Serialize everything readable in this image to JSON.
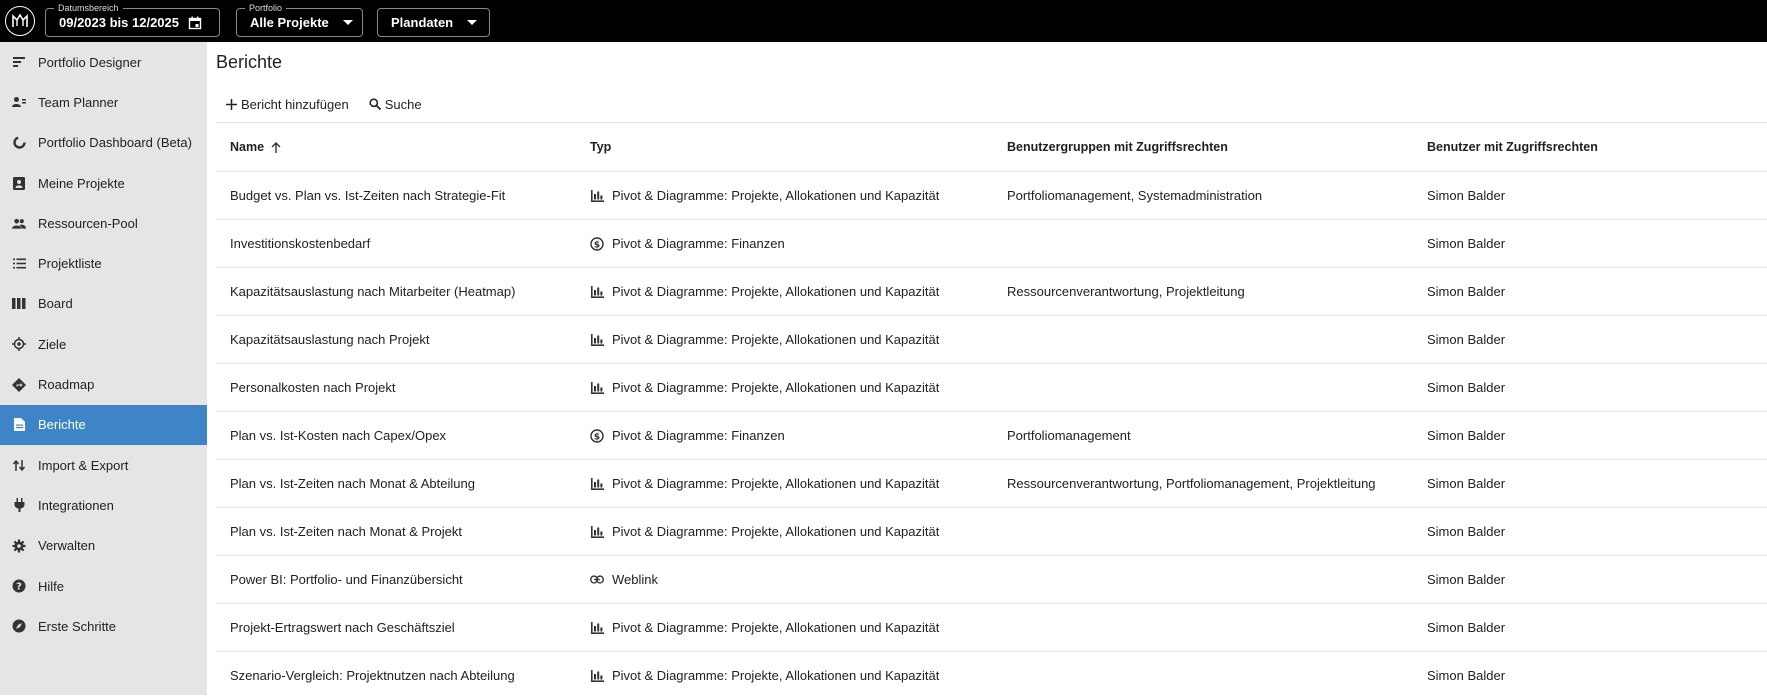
{
  "topbar": {
    "date_range": {
      "legend": "Datumsbereich",
      "value": "09/2023 bis 12/2025"
    },
    "portfolio": {
      "legend": "Portfolio",
      "value": "Alle Projekte"
    },
    "data_select": {
      "value": "Plandaten"
    }
  },
  "sidebar": {
    "items": [
      {
        "label": "Portfolio Designer",
        "icon": "portfolio-designer-icon"
      },
      {
        "label": "Team Planner",
        "icon": "team-planner-icon"
      },
      {
        "label": "Portfolio Dashboard (Beta)",
        "icon": "dashboard-icon"
      },
      {
        "label": "Meine Projekte",
        "icon": "my-projects-icon"
      },
      {
        "label": "Ressourcen-Pool",
        "icon": "people-icon"
      },
      {
        "label": "Projektliste",
        "icon": "list-icon"
      },
      {
        "label": "Board",
        "icon": "board-icon"
      },
      {
        "label": "Ziele",
        "icon": "target-icon"
      },
      {
        "label": "Roadmap",
        "icon": "roadmap-icon"
      },
      {
        "label": "Berichte",
        "icon": "report-icon",
        "active": true
      },
      {
        "label": "Import & Export",
        "icon": "import-export-icon"
      },
      {
        "label": "Integrationen",
        "icon": "plug-icon"
      },
      {
        "label": "Verwalten",
        "icon": "gear-icon"
      },
      {
        "label": "Hilfe",
        "icon": "help-icon"
      },
      {
        "label": "Erste Schritte",
        "icon": "compass-icon"
      }
    ]
  },
  "main": {
    "title": "Berichte",
    "add_label": "Bericht hinzufügen",
    "search_label": "Suche",
    "columns": [
      "Name",
      "Typ",
      "Benutzergruppen mit Zugriffsrechten",
      "Benutzer mit Zugriffsrechten"
    ],
    "rows": [
      {
        "name": "Budget vs. Plan vs. Ist-Zeiten nach Strategie-Fit",
        "type": "Pivot & Diagramme: Projekte, Allokationen und Kapazität",
        "type_icon": "bar-chart-icon",
        "groups": "Portfoliomanagement, Systemadministration",
        "users": "Simon Balder"
      },
      {
        "name": "Investitionskostenbedarf",
        "type": "Pivot & Diagramme: Finanzen",
        "type_icon": "dollar-icon",
        "groups": "",
        "users": "Simon Balder"
      },
      {
        "name": "Kapazitätsauslastung nach Mitarbeiter (Heatmap)",
        "type": "Pivot & Diagramme: Projekte, Allokationen und Kapazität",
        "type_icon": "bar-chart-icon",
        "groups": "Ressourcenverantwortung, Projektleitung",
        "users": "Simon Balder"
      },
      {
        "name": "Kapazitätsauslastung nach Projekt",
        "type": "Pivot & Diagramme: Projekte, Allokationen und Kapazität",
        "type_icon": "bar-chart-icon",
        "groups": "",
        "users": "Simon Balder"
      },
      {
        "name": "Personalkosten nach Projekt",
        "type": "Pivot & Diagramme: Projekte, Allokationen und Kapazität",
        "type_icon": "bar-chart-icon",
        "groups": "",
        "users": "Simon Balder"
      },
      {
        "name": "Plan vs. Ist-Kosten nach Capex/Opex",
        "type": "Pivot & Diagramme: Finanzen",
        "type_icon": "dollar-icon",
        "groups": "Portfoliomanagement",
        "users": "Simon Balder"
      },
      {
        "name": "Plan vs. Ist-Zeiten nach Monat & Abteilung",
        "type": "Pivot & Diagramme: Projekte, Allokationen und Kapazität",
        "type_icon": "bar-chart-icon",
        "groups": "Ressourcenverantwortung, Portfoliomanagement, Projektleitung",
        "users": "Simon Balder"
      },
      {
        "name": "Plan vs. Ist-Zeiten nach Monat & Projekt",
        "type": "Pivot & Diagramme: Projekte, Allokationen und Kapazität",
        "type_icon": "bar-chart-icon",
        "groups": "",
        "users": "Simon Balder"
      },
      {
        "name": "Power BI: Portfolio- und Finanzübersicht",
        "type": "Weblink",
        "type_icon": "link-icon",
        "groups": "",
        "users": "Simon Balder"
      },
      {
        "name": "Projekt-Ertragswert nach Geschäftsziel",
        "type": "Pivot & Diagramme: Projekte, Allokationen und Kapazität",
        "type_icon": "bar-chart-icon",
        "groups": "",
        "users": "Simon Balder"
      },
      {
        "name": "Szenario-Vergleich: Projektnutzen nach Abteilung",
        "type": "Pivot & Diagramme: Projekte, Allokationen und Kapazität",
        "type_icon": "bar-chart-icon",
        "groups": "",
        "users": "Simon Balder"
      }
    ]
  },
  "colors": {
    "topbar": "#000000",
    "sidebar": "#e5e5e5",
    "active": "#3d85c6"
  }
}
